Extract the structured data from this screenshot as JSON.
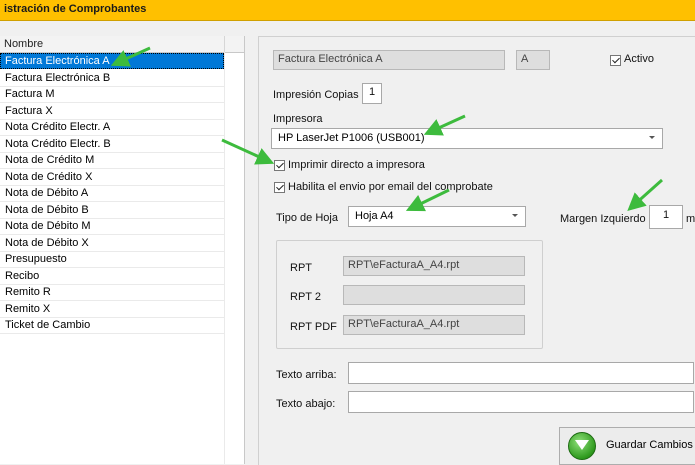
{
  "title": "istración de Comprobantes",
  "list": {
    "header": "Nombre",
    "selected_index": 0,
    "items": [
      "Factura Electrónica A",
      "Factura Electrónica B",
      "Factura M",
      "Factura X",
      "Nota Crédito Electr. A",
      "Nota Crédito Electr. B",
      "Nota de Crédito M",
      "Nota de Crédito X",
      "Nota de Débito A",
      "Nota de Débito B",
      "Nota de Débito M",
      "Nota de Débito X",
      "Presupuesto",
      "Recibo",
      "Remito R",
      "Remito X",
      "Ticket de Cambio"
    ]
  },
  "form": {
    "name_value": "Factura Electrónica A",
    "letter_value": "A",
    "activo_label": "Activo",
    "activo_checked": true,
    "impresion_copias_label": "Impresión Copias",
    "impresion_copias_value": "1",
    "impresora_label": "Impresora",
    "impresora_value": "HP LaserJet P1006 (USB001)",
    "imprimir_directo_label": "Imprimir directo a impresora",
    "imprimir_directo_checked": true,
    "habilita_email_label": "Habilita el envio por email del comprobate",
    "habilita_email_checked": true,
    "tipo_hoja_label": "Tipo de Hoja",
    "tipo_hoja_value": "Hoja A4",
    "margen_izq_label": "Margen Izquierdo",
    "margen_izq_value": "1",
    "margen_unit": "m",
    "rpt_label": "RPT",
    "rpt_value": "RPT\\eFacturaA_A4.rpt",
    "rpt2_label": "RPT 2",
    "rpt2_value": "",
    "rptpdf_label": "RPT PDF",
    "rptpdf_value": "RPT\\eFacturaA_A4.rpt",
    "texto_arriba_label": "Texto arriba:",
    "texto_arriba_value": "",
    "texto_abajo_label": "Texto abajo:",
    "texto_abajo_value": "",
    "guardar_label": "Guardar Cambios"
  },
  "colors": {
    "title_bar": "#ffc000",
    "selection": "#0078d7",
    "annotation_arrow": "#3dbb3d"
  }
}
